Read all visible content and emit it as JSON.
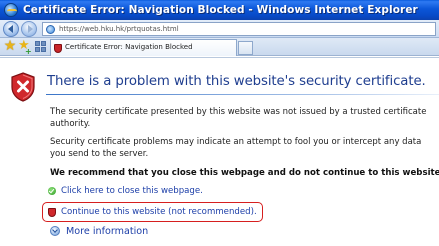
{
  "window": {
    "title": "Certificate Error: Navigation Blocked - Windows Internet Explorer"
  },
  "address_bar": {
    "url": "https://web.hku.hk/prtquotas.html"
  },
  "tabs": [
    {
      "label": "Certificate Error: Navigation Blocked"
    }
  ],
  "page": {
    "heading": "There is a problem with this website's security certificate.",
    "paragraph_1": "The security certificate presented by this website was not issued by a trusted certificate authority.",
    "paragraph_2": "Security certificate problems may indicate an attempt to fool you or intercept any data you send to the server.",
    "recommendation": "We recommend that you close this webpage and do not continue to this website.",
    "close_link": "Click here to close this webpage.",
    "continue_link": "Continue to this website (not recommended).",
    "more_info": "More information"
  },
  "colors": {
    "title_bar": "#0b56d8",
    "heading": "#1f3e8f",
    "link": "#1c3ea8",
    "highlight_box": "#d61f1f",
    "shield_red": "#d0282c"
  },
  "icons": {
    "title": "ie-logo-icon",
    "error": "red-shield-x-icon",
    "close_link": "green-check-icon",
    "continue_link": "red-shield-icon",
    "more_info": "chevron-down-icon"
  }
}
